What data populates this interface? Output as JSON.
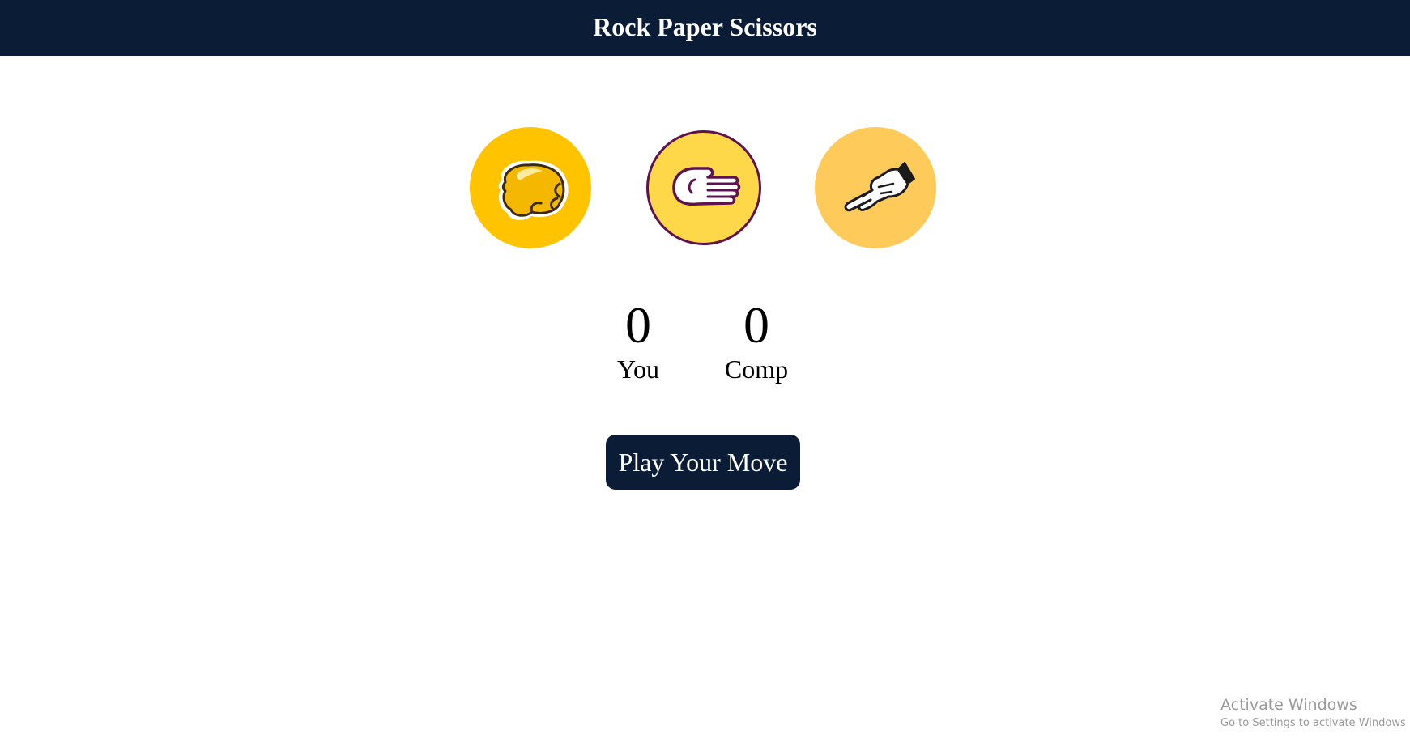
{
  "header": {
    "title": "Rock Paper Scissors"
  },
  "choices": [
    {
      "id": "rock",
      "icon": "fist-rock-icon",
      "color": "#ffc300"
    },
    {
      "id": "paper",
      "icon": "open-hand-paper-icon",
      "color": "#ffd84a"
    },
    {
      "id": "scissors",
      "icon": "two-finger-scissors-icon",
      "color": "#fecb5a"
    }
  ],
  "scoreboard": {
    "user": {
      "score": "0",
      "label": "You"
    },
    "comp": {
      "score": "0",
      "label": "Comp"
    }
  },
  "message": {
    "label": "Play Your Move"
  },
  "watermark": {
    "line1": "Activate Windows",
    "line2": "Go to Settings to activate Windows"
  },
  "colors": {
    "header_bg": "#0b1d36",
    "button_bg": "#0b1d36",
    "paper_border": "#5e1350"
  }
}
